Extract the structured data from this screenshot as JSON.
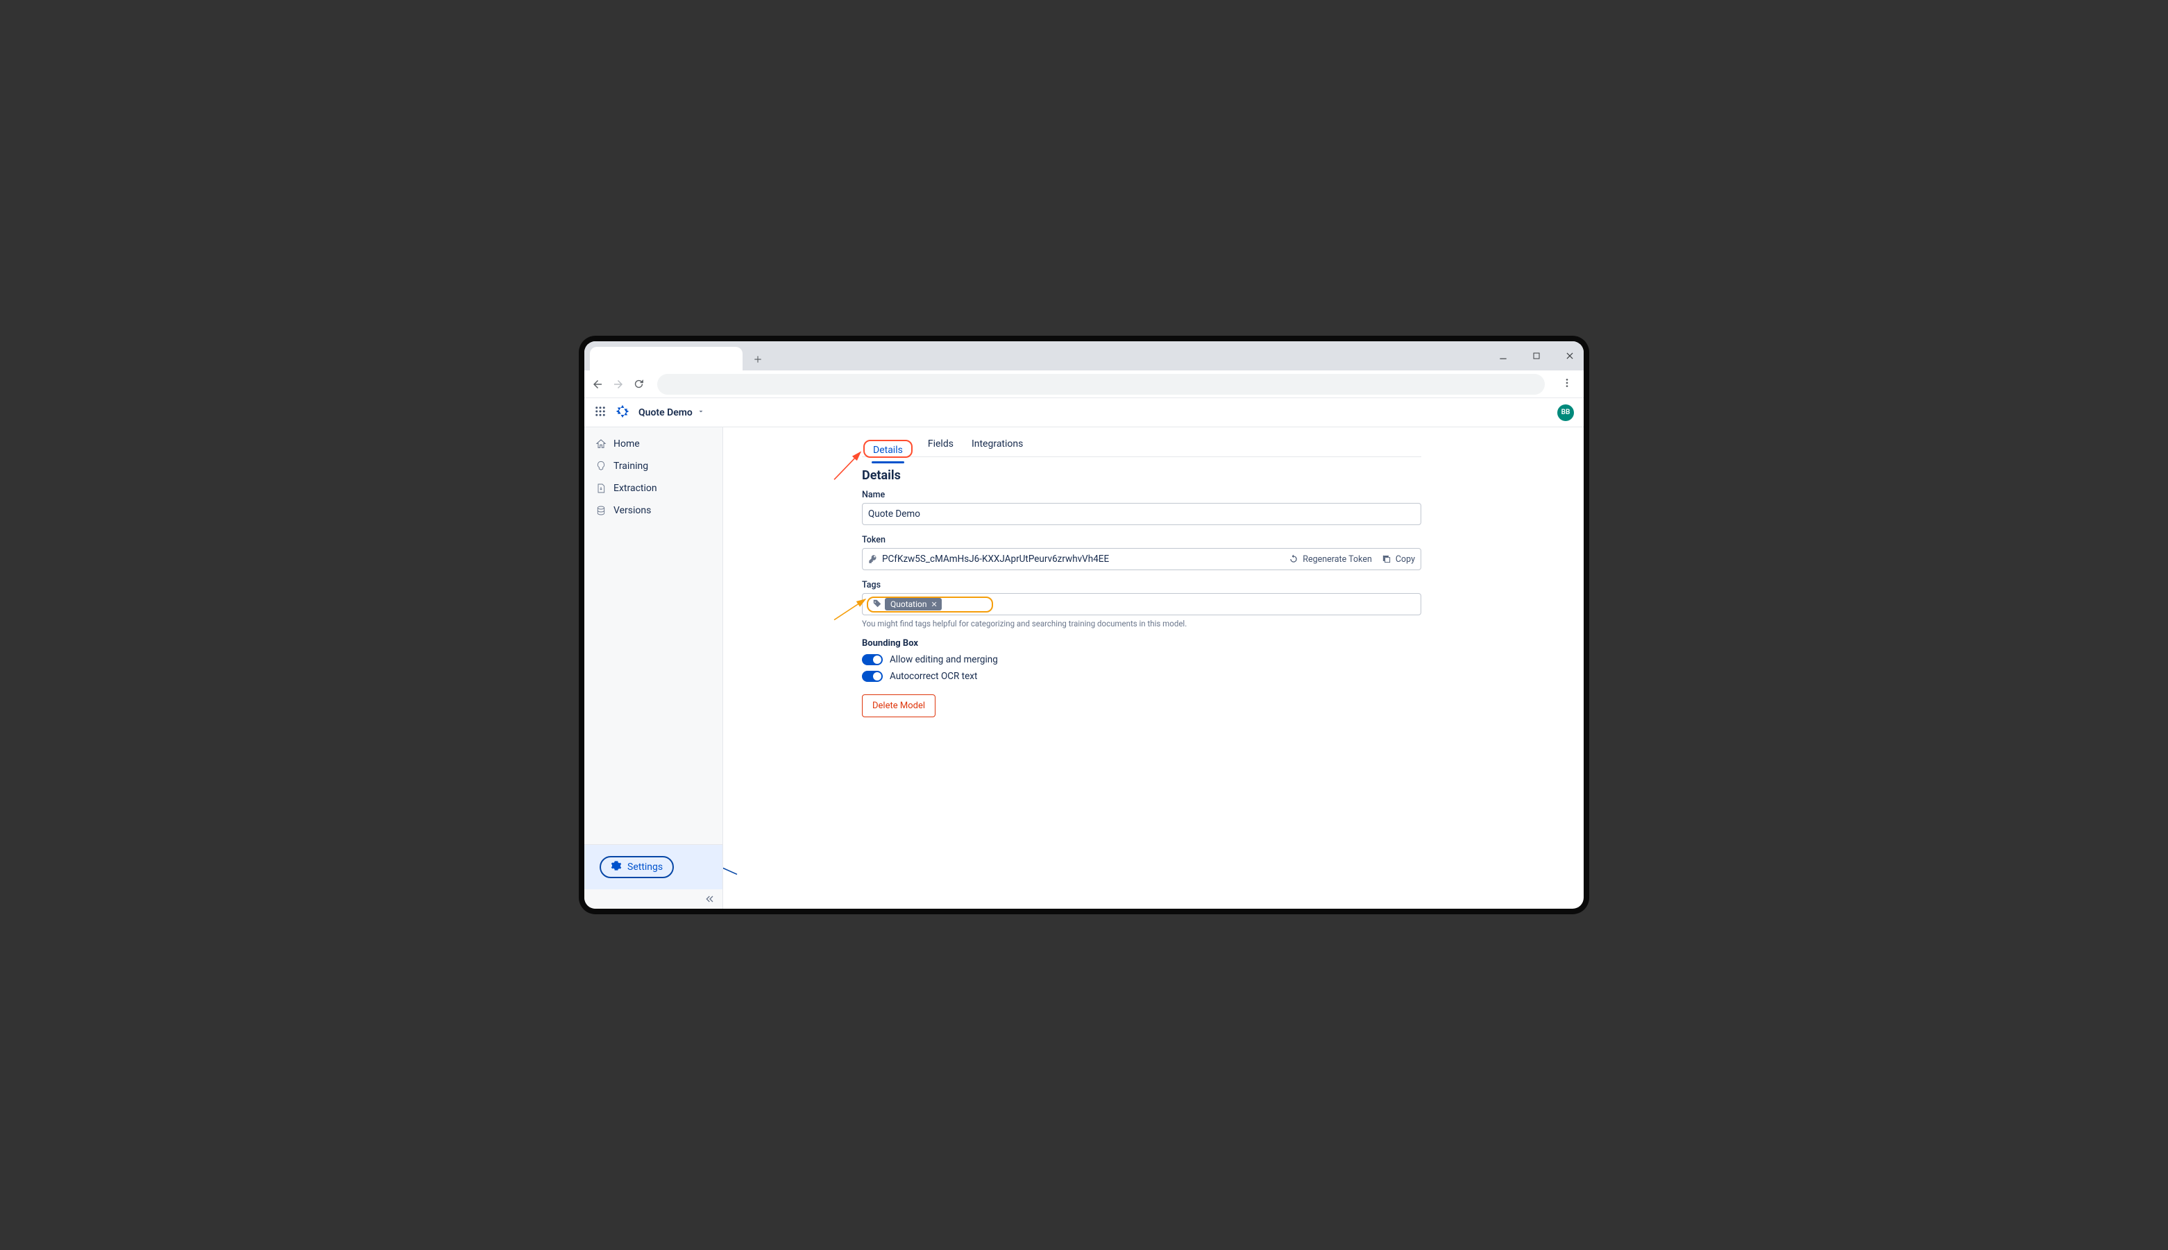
{
  "project": {
    "name": "Quote Demo",
    "avatar_initials": "BB"
  },
  "sidebar": {
    "items": [
      {
        "label": "Home"
      },
      {
        "label": "Training"
      },
      {
        "label": "Extraction"
      },
      {
        "label": "Versions"
      }
    ],
    "settings_label": "Settings"
  },
  "tabs": [
    {
      "label": "Details",
      "active": true
    },
    {
      "label": "Fields",
      "active": false
    },
    {
      "label": "Integrations",
      "active": false
    }
  ],
  "details": {
    "heading": "Details",
    "name_label": "Name",
    "name_value": "Quote Demo",
    "token_label": "Token",
    "token_value": "PCfKzw5S_cMAmHsJ6-KXXJAprUtPeurv6zrwhvVh4EE",
    "regenerate_label": "Regenerate Token",
    "copy_label": "Copy",
    "tags_label": "Tags",
    "tags": [
      {
        "name": "Quotation"
      }
    ],
    "tags_help": "You might find tags helpful for categorizing and searching training documents in this model.",
    "bounding_box_label": "Bounding Box",
    "toggle_edit_label": "Allow editing and merging",
    "toggle_edit_on": true,
    "toggle_ocr_label": "Autocorrect OCR text",
    "toggle_ocr_on": true,
    "delete_label": "Delete Model"
  }
}
